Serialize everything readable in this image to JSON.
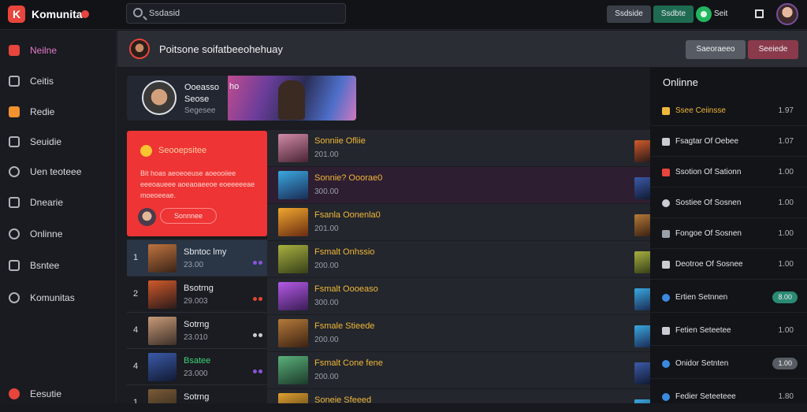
{
  "topbar": {
    "logo_glyph": "K",
    "brand": "Komunita",
    "search_placeholder": "Ssdasid",
    "btn1": "Ssdside",
    "btn2": "Ssdbte",
    "user_label": "Seit"
  },
  "sidebar": {
    "items": [
      {
        "label": "Neilne"
      },
      {
        "label": "Ceitis"
      },
      {
        "label": "Redie"
      },
      {
        "label": "Seuidie"
      },
      {
        "label": "Uen teoteee"
      },
      {
        "label": "Dnearie"
      },
      {
        "label": "Onlinne"
      },
      {
        "label": "Bsntee"
      },
      {
        "label": "Komunitas"
      }
    ],
    "bottom_label": "Eesutie"
  },
  "page_header": {
    "title": "Poitsone soifatbeeohehuay",
    "btn1": "Saeoraeeo",
    "btn2": "Seeiede"
  },
  "featured": {
    "line1": "Ooeasso",
    "line2": "Seose",
    "line3": "Segesee",
    "banner_text": "ho"
  },
  "promo": {
    "title": "Seooepsitee",
    "body": "Bit hoas aeoeoeuse aoeooiiee eeeoaueee aoeaoaeeoe eoeeeeeae moeoeeae.",
    "button": "Sonnnee"
  },
  "left_list": [
    {
      "num": "1",
      "name": "Sbntoc lmy",
      "value": "23.00",
      "name_color": "default",
      "dots": "#8a54d6"
    },
    {
      "num": "2",
      "name": "Bsotrng",
      "value": "29.003",
      "name_color": "default",
      "dots": "#e2472e"
    },
    {
      "num": "4",
      "name": "Sotrng",
      "value": "23.010",
      "name_color": "default",
      "dots": "#c9ccd2"
    },
    {
      "num": "4",
      "name": "Bsatee",
      "value": "23.000",
      "name_color": "green",
      "dots": "#8a54d6"
    },
    {
      "num": "1",
      "name": "Sotrng",
      "value": "",
      "name_color": "default",
      "dots": "#8a54d6"
    }
  ],
  "mid_list": [
    {
      "name": "Sonniie Ofliie",
      "value": "201.00"
    },
    {
      "name": "Sonnie? Ooorae0",
      "value": "300.00"
    },
    {
      "name": "Fsanla Oonenla0",
      "value": "201.00"
    },
    {
      "name": "Fsmalt Onhssio",
      "value": "200.00"
    },
    {
      "name": "Fsmalt Oooeaso",
      "value": "300.00"
    },
    {
      "name": "Fsmale Stieede",
      "value": "200.00"
    },
    {
      "name": "Fsmalt Cone fene",
      "value": "200.00"
    },
    {
      "name": "Soneie Sfeeed",
      "value": ""
    }
  ],
  "right_panel": {
    "title": "Onlinne",
    "items": [
      {
        "name": "Ssee Ceiinsse",
        "value": "1.97",
        "style": "gold",
        "badge": ""
      },
      {
        "name": "Fsagtar Of Oebee",
        "value": "1.07",
        "style": "default",
        "badge": ""
      },
      {
        "name": "Ssotion Of Sationn",
        "value": "1.00",
        "style": "default",
        "badge": ""
      },
      {
        "name": "Sostiee Of Sosnen",
        "value": "1.00",
        "style": "default",
        "badge": ""
      },
      {
        "name": "Fongoe Of Sosnen",
        "value": "1.00",
        "style": "default",
        "badge": ""
      },
      {
        "name": "Deotroe Of Sosnee",
        "value": "1.00",
        "style": "default",
        "badge": ""
      },
      {
        "name": "Ertien Setnnen",
        "value": "",
        "style": "pill",
        "badge": "8.00"
      },
      {
        "name": "Fetien Seteetee",
        "value": "1.00",
        "style": "pill",
        "badge": ""
      },
      {
        "name": "Onidor Setnten",
        "value": "",
        "style": "pill",
        "badge": "1.00"
      },
      {
        "name": "Fedier Seteeteee",
        "value": "1.80",
        "style": "pill",
        "badge": ""
      }
    ]
  },
  "colors": {
    "accent_red": "#ee3434",
    "active_pink": "#e678c9",
    "gold": "#f0b83a",
    "green": "#3ed27a",
    "badge_green": "#2a8a74",
    "badge_gray": "#575c64"
  }
}
